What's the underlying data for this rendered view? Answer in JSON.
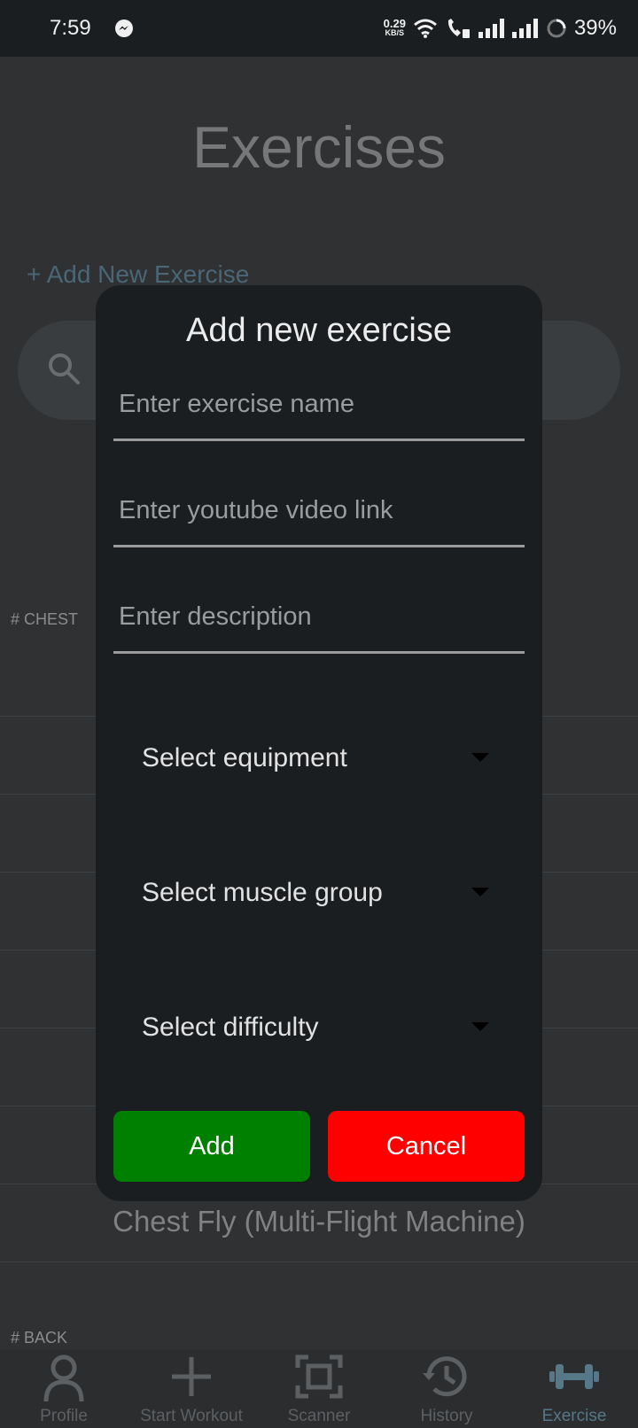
{
  "status_bar": {
    "time": "7:59",
    "net_speed_value": "0.29",
    "net_speed_unit": "KB/S",
    "battery": "39%"
  },
  "page": {
    "title": "Exercises",
    "add_link": "+ Add New Exercise",
    "section_chest": "# CHEST",
    "section_back": "# BACK",
    "visible_item": "Chest Fly (Multi-Flight Machine)"
  },
  "dialog": {
    "title": "Add new exercise",
    "name_placeholder": "Enter exercise name",
    "video_placeholder": "Enter youtube video link",
    "description_placeholder": "Enter description",
    "equipment_label": "Select equipment",
    "muscle_label": "Select muscle group",
    "difficulty_label": "Select difficulty",
    "add_button": "Add",
    "cancel_button": "Cancel"
  },
  "bottom_nav": {
    "items": [
      {
        "label": "Profile",
        "icon": "person-icon"
      },
      {
        "label": "Start Workout",
        "icon": "plus-icon"
      },
      {
        "label": "Scanner",
        "icon": "scanner-icon"
      },
      {
        "label": "History",
        "icon": "history-icon"
      },
      {
        "label": "Exercise",
        "icon": "dumbbell-icon",
        "active": true
      }
    ]
  },
  "colors": {
    "add_button": "#008000",
    "cancel_button": "#ff0000",
    "accent": "#567889"
  }
}
